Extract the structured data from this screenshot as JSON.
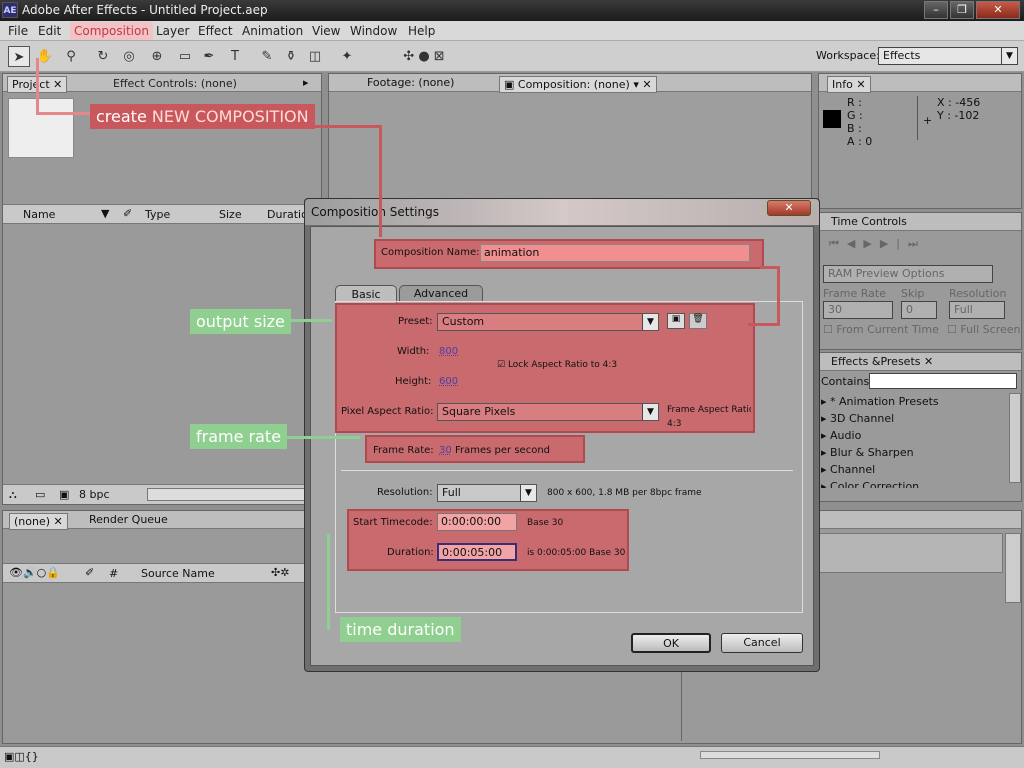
{
  "window": {
    "title": "Adobe After Effects - Untitled Project.aep",
    "app_icon": "AE",
    "min": "–",
    "max": "❐",
    "close": "✕"
  },
  "menu": [
    "File",
    "Edit",
    "Composition",
    "Layer",
    "Effect",
    "Animation",
    "View",
    "Window",
    "Help"
  ],
  "workspace": {
    "label": "Workspace:",
    "value": "Effects"
  },
  "project_panel": {
    "tab": "Project",
    "tab2": "Effect Controls: (none)",
    "cols": [
      "Name",
      "Type",
      "Size",
      "Duratio"
    ],
    "bpc": "8 bpc"
  },
  "viewer": {
    "footage_tab": "Footage: (none)",
    "comp_tab": "Composition: (none)"
  },
  "info": {
    "tab": "Info",
    "r": "R :",
    "g": "G :",
    "b": "B :",
    "a": "A : 0",
    "x": "X : -456",
    "y": "Y : -102"
  },
  "time_controls": {
    "tab": "Time Controls",
    "ram": "RAM Preview Options",
    "frame_rate": "Frame Rate",
    "skip": "Skip",
    "resolution": "Resolution",
    "fr_val": "30",
    "skip_val": "0",
    "res_val": "Full",
    "from_current": "From Current Time",
    "full_screen": "Full Screen"
  },
  "effects": {
    "tab": "Effects &Presets",
    "contains": "Contains:",
    "items": [
      "* Animation Presets",
      "3D Channel",
      "Audio",
      "Blur & Sharpen",
      "Channel",
      "Color Correction"
    ]
  },
  "timeline": {
    "tab": "(none)",
    "tab2": "Render Queue",
    "cols": [
      "#",
      "Source Name"
    ]
  },
  "dialog": {
    "title": "Composition Settings",
    "comp_name_label": "Composition Name:",
    "comp_name": "animation",
    "tabs": [
      "Basic",
      "Advanced"
    ],
    "preset_label": "Preset:",
    "preset": "Custom",
    "width_label": "Width:",
    "width": "800",
    "height_label": "Height:",
    "height": "600",
    "lock": "Lock Aspect Ratio to 4:3",
    "par_label": "Pixel Aspect Ratio:",
    "par": "Square Pixels",
    "far_label": "Frame Aspect Ratio:",
    "far_value": "4:3",
    "fr_label": "Frame Rate:",
    "fr_value": "30",
    "fr_unit": "Frames per second",
    "res_label": "Resolution:",
    "res": "Full",
    "res_info": "800 x 600, 1.8 MB per 8bpc frame",
    "start_label": "Start Timecode:",
    "start": "0:00:00:00",
    "start_base": "Base 30",
    "dur_label": "Duration:",
    "dur": "0:00:05:00",
    "dur_info": "is 0:00:05:00  Base 30",
    "ok": "OK",
    "cancel": "Cancel"
  },
  "annotations": {
    "new_comp_a": "create ",
    "new_comp_b": "NEW COMPOSITION",
    "output": "output size",
    "frame_rate": "frame rate",
    "duration": "time duration"
  },
  "colors": {
    "highlight_red": "#c9585c",
    "highlight_green": "#8fcf8f"
  }
}
